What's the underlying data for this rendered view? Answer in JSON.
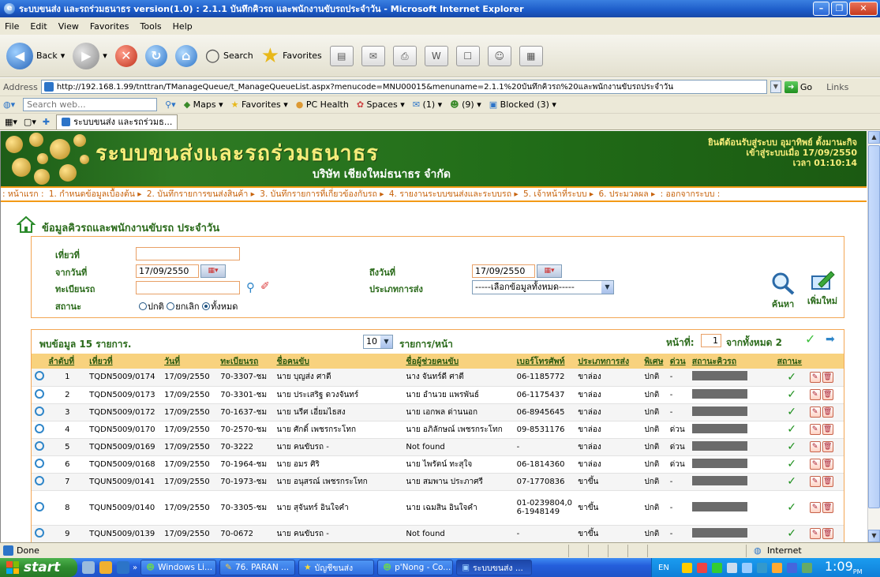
{
  "window": {
    "title": "ระบบขนส่ง และรถร่วมธนาธร version(1.0) : 2.1.1 บันทึกคิวรถ และพนักงานขับรถประจำวัน - Microsoft Internet Explorer"
  },
  "menu": [
    "File",
    "Edit",
    "View",
    "Favorites",
    "Tools",
    "Help"
  ],
  "toolbar": {
    "back": "Back",
    "search": "Search",
    "favorites": "Favorites"
  },
  "address": {
    "label": "Address",
    "url": "http://192.168.1.99/tnttran/TManageQueue/t_ManageQueueList.aspx?menucode=MNU00015&menuname=2.1.1%20บันทึกคิวรถ%20และพนักงานขับรถประจำวัน",
    "go": "Go",
    "links": "Links"
  },
  "linksbar": {
    "search_placeholder": "Search web...",
    "items": [
      "Maps",
      "Favorites",
      "PC Health",
      "Spaces",
      "(1)",
      "(9)",
      "Blocked (3)"
    ]
  },
  "tab": {
    "title": "ระบบขนส่ง และรถร่วมธ..."
  },
  "banner": {
    "system_name": "ระบบขนส่งและรถร่วมธนาธร",
    "company": "บริษัท เชียงใหม่ธนาธร จำกัด",
    "welcome_line1": "ยินดีต้อนรับสู่ระบบ อุมาทิพย์ ตั้งมานะกิจ",
    "welcome_line2": "เข้าสู่ระบบเมื่อ 17/09/2550",
    "welcome_line3": "เวลา 01:10:14"
  },
  "nav": [
    ": หน้าแรก :",
    "1. กำหนดข้อมูลเบื้องต้น ▸",
    "2. บันทึกรายการขนส่งสินค้า ▸",
    "3. บันทึกรายการที่เกี่ยวข้องกับรถ ▸",
    "4. รายงานระบบขนส่งและระบบรถ ▸",
    "5. เจ้าหน้าที่ระบบ ▸",
    "6. ประมวลผล ▸",
    ": ออกจากระบบ :"
  ],
  "page": {
    "title": "ข้อมูลคิวรถและพนักงานขับรถ ประจำวัน"
  },
  "form": {
    "doc_label": "เที่ยวที่",
    "from_label": "จากวันที่",
    "from_value": "17/09/2550",
    "to_label": "ถึงวันที่",
    "to_value": "17/09/2550",
    "plate_label": "ทะเบียนรถ",
    "transport_type_label": "ประเภทการส่ง",
    "transport_type_value": "-----เลือกข้อมูลทั้งหมด-----",
    "status_label": "สถานะ",
    "radio_normal": "ปกติ",
    "radio_cancel": "ยกเลิก",
    "radio_all": "ทั้งหมด",
    "search_btn": "ค้นหา",
    "add_btn": "เพิ่มใหม่"
  },
  "results": {
    "found_text": "พบข้อมูล 15 รายการ.",
    "per_page": "10",
    "per_page_label": "รายการ/หน้า",
    "page_label": "หน้าที่:",
    "page_value": "1",
    "total_pages": "จากทั้งหมด 2"
  },
  "table": {
    "headers": [
      "ลำดับที่",
      "เที่ยวที่",
      "วันที่",
      "ทะเบียนรถ",
      "ชื่อคนขับ",
      "ชื่อผู้ช่วยคนขับ",
      "เบอร์โทรศัพท์",
      "ประเภทการส่ง",
      "พิเศษ",
      "ด่วน",
      "สถานะคิวรถ",
      "สถานะ"
    ],
    "rows": [
      {
        "no": "1",
        "trip": "TQDN5009/0174",
        "date": "17/09/2550",
        "plate": "70-3307-ชม",
        "driver": "นาย บุญส่ง ศาตี",
        "helper": "นาง จันทร์ดี ศาตี",
        "phone": "06-1185772",
        "type": "ขาล่อง",
        "special": "ปกติ",
        "urgent": "-"
      },
      {
        "no": "2",
        "trip": "TQDN5009/0173",
        "date": "17/09/2550",
        "plate": "70-3301-ชม",
        "driver": "นาย ประเสริฐ ดวงจันทร์",
        "helper": "นาย อำนวย แพรพันธ์",
        "phone": "06-1175437",
        "type": "ขาล่อง",
        "special": "ปกติ",
        "urgent": "-"
      },
      {
        "no": "3",
        "trip": "TQDN5009/0172",
        "date": "17/09/2550",
        "plate": "70-1637-ชม",
        "driver": "นาย นรีศ เอี่ยมไธสง",
        "helper": "นาย เอกพล ด่านนอก",
        "phone": "06-8945645",
        "type": "ขาล่อง",
        "special": "ปกติ",
        "urgent": "-"
      },
      {
        "no": "4",
        "trip": "TQDN5009/0170",
        "date": "17/09/2550",
        "plate": "70-2570-ชม",
        "driver": "นาย ศักดิ์ เพชรกระโทก",
        "helper": "นาย อภิลักษณ์ เพชรกระโทก",
        "phone": "09-8531176",
        "type": "ขาล่อง",
        "special": "ปกติ",
        "urgent": "ด่วน"
      },
      {
        "no": "5",
        "trip": "TQDN5009/0169",
        "date": "17/09/2550",
        "plate": "70-3222",
        "driver": "นาย คนขับรถ -",
        "helper": "Not found",
        "phone": "-",
        "type": "ขาล่อง",
        "special": "ปกติ",
        "urgent": "ด่วน"
      },
      {
        "no": "6",
        "trip": "TQDN5009/0168",
        "date": "17/09/2550",
        "plate": "70-1964-ชม",
        "driver": "นาย อมร ศิริ",
        "helper": "นาย ไพรัตน์ ทะสุใจ",
        "phone": "06-1814360",
        "type": "ขาล่อง",
        "special": "ปกติ",
        "urgent": "ด่วน"
      },
      {
        "no": "7",
        "trip": "TQUN5009/0141",
        "date": "17/09/2550",
        "plate": "70-1973-ชม",
        "driver": "นาย อนุสรณ์ เพชรกระโทก",
        "helper": "นาย สมพาน ประภาศรี",
        "phone": "07-1770836",
        "type": "ขาขึ้น",
        "special": "ปกติ",
        "urgent": "-"
      },
      {
        "no": "8",
        "trip": "TQUN5009/0140",
        "date": "17/09/2550",
        "plate": "70-3305-ชม",
        "driver": "นาย สุจันทร์ อินใจคำ",
        "helper": "นาย เฉมสิน อินใจคำ",
        "phone": "01-0239804,06-1948149",
        "type": "ขาขึ้น",
        "special": "ปกติ",
        "urgent": "-"
      },
      {
        "no": "9",
        "trip": "TQUN5009/0139",
        "date": "17/09/2550",
        "plate": "70-0672",
        "driver": "นาย คนขับรถ -",
        "helper": "Not found",
        "phone": "-",
        "type": "ขาขึ้น",
        "special": "ปกติ",
        "urgent": "-"
      }
    ]
  },
  "status": {
    "left": "Done",
    "zone": "Internet"
  },
  "taskbar": {
    "start": "start",
    "items": [
      "Windows Li...",
      "76. PARAN ...",
      "บัญชีขนส่ง",
      "p'Nong - Co...",
      "ระบบขนส่ง ..."
    ],
    "lang": "EN",
    "clock": "1:09",
    "ampm": "PM"
  },
  "colors": {
    "banner_green": "#216d18",
    "nav_orange": "#f39a16",
    "header_yellow": "#f8d27e",
    "title_green": "#2a6a1a"
  }
}
